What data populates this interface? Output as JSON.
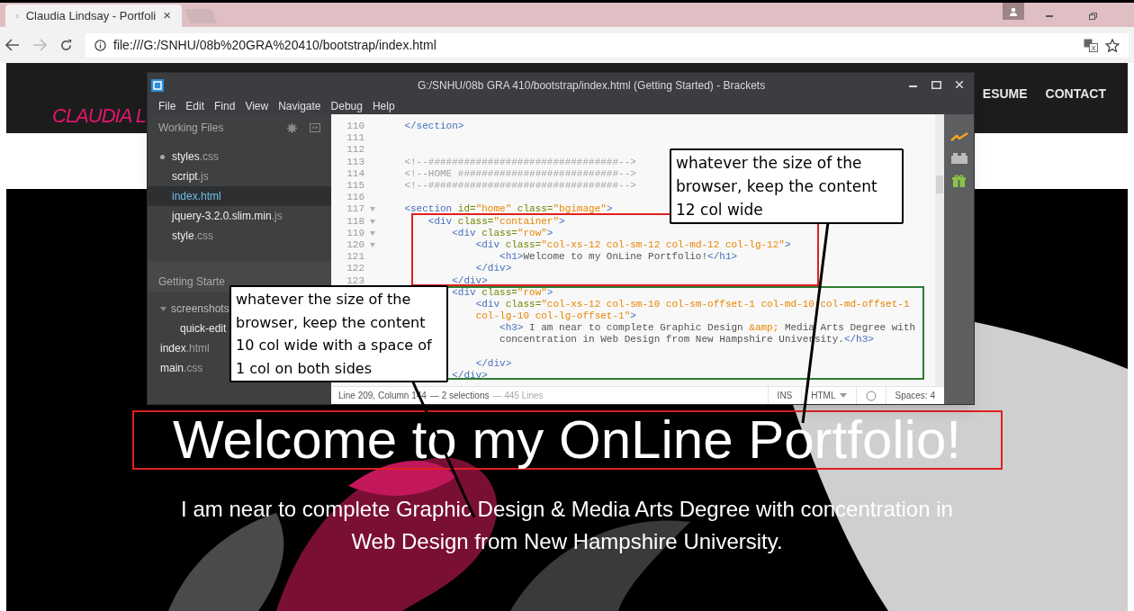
{
  "browser": {
    "tab": {
      "title": "Claudia Lindsay - Portfoli",
      "close": "×"
    },
    "url": "file:///G:/SNHU/08b%20GRA%20410/bootstrap/index.html"
  },
  "page": {
    "logo": "CLAUDIA L",
    "nav": [
      "ESUME",
      "CONTACT"
    ],
    "hero": {
      "heading": "Welcome to my OnLine Portfolio!",
      "subheading": "I am near to complete Graphic Design & Media Arts Degree with concentration in Web Design from New Hampshire University."
    }
  },
  "editor": {
    "title": "G:/SNHU/08b GRA 410/bootstrap/index.html (Getting Started) - Brackets",
    "menu": [
      "File",
      "Edit",
      "Find",
      "View",
      "Navigate",
      "Debug",
      "Help"
    ],
    "sidebar": {
      "working_files_title": "Working Files",
      "working_files": [
        {
          "name": "styles",
          "ext": ".css",
          "modified": true,
          "selected": false
        },
        {
          "name": "script",
          "ext": ".js",
          "modified": false,
          "selected": false
        },
        {
          "name": "index",
          "ext": ".html",
          "modified": false,
          "selected": true
        },
        {
          "name": "jquery-3.2.0.slim.min",
          "ext": ".js",
          "modified": false,
          "selected": false
        },
        {
          "name": "style",
          "ext": ".css",
          "modified": false,
          "selected": false
        }
      ],
      "project_title": "Getting Starte",
      "project_tree": [
        {
          "name": "screenshots",
          "expanded": true,
          "children": [
            {
              "name": "quick-edit"
            }
          ]
        },
        {
          "name": "index",
          "ext": ".html"
        },
        {
          "name": "main",
          "ext": ".css"
        }
      ]
    },
    "code": [
      {
        "number": "110",
        "fold": false,
        "tokens": [
          {
            "kind": "tag",
            "text": "    </section>"
          }
        ]
      },
      {
        "number": "111",
        "fold": false
      },
      {
        "number": "112",
        "fold": false
      },
      {
        "number": "113",
        "fold": false,
        "tokens": [
          {
            "kind": "comment",
            "text": "    <!--################################-->"
          }
        ]
      },
      {
        "number": "114",
        "fold": false,
        "tokens": [
          {
            "kind": "comment",
            "text": "    <!--HOME ###########################-->"
          }
        ]
      },
      {
        "number": "115",
        "fold": false,
        "tokens": [
          {
            "kind": "comment",
            "text": "    <!--################################-->"
          }
        ]
      },
      {
        "number": "116",
        "fold": false
      },
      {
        "number": "117",
        "fold": true,
        "tokens": [
          {
            "kind": "tag",
            "text": "    <section"
          },
          {
            "kind": "attr",
            "text": " id="
          },
          {
            "kind": "string",
            "text": "\"home\""
          },
          {
            "kind": "attr",
            "text": " class="
          },
          {
            "kind": "string",
            "text": "\"bgimage\""
          },
          {
            "kind": "tag",
            "text": ">"
          }
        ]
      },
      {
        "number": "118",
        "fold": true,
        "tokens": [
          {
            "kind": "tag",
            "text": "        <div"
          },
          {
            "kind": "attr",
            "text": " class="
          },
          {
            "kind": "string",
            "text": "\"container\""
          },
          {
            "kind": "tag",
            "text": ">"
          }
        ]
      },
      {
        "number": "119",
        "fold": true,
        "tokens": [
          {
            "kind": "tag",
            "text": "            <div"
          },
          {
            "kind": "attr",
            "text": " class="
          },
          {
            "kind": "string",
            "text": "\"row\""
          },
          {
            "kind": "tag",
            "text": ">"
          }
        ]
      },
      {
        "number": "120",
        "fold": true,
        "tokens": [
          {
            "kind": "tag",
            "text": "                <div"
          },
          {
            "kind": "attr",
            "text": " class="
          },
          {
            "kind": "string",
            "text": "\"col-xs-12 col-sm-12 col-md-12 col-lg-12\""
          },
          {
            "kind": "tag",
            "text": ">"
          }
        ]
      },
      {
        "number": "121",
        "fold": false,
        "tokens": [
          {
            "kind": "tag",
            "text": "                    <h1>"
          },
          {
            "kind": "text",
            "text": "Welcome to my OnLine Portfolio!"
          },
          {
            "kind": "tag",
            "text": "</h1>"
          }
        ]
      },
      {
        "number": "122",
        "fold": false,
        "tokens": [
          {
            "kind": "tag",
            "text": "                </div>"
          }
        ]
      },
      {
        "number": "123",
        "fold": false,
        "tokens": [
          {
            "kind": "tag",
            "text": "            </div>"
          }
        ]
      },
      {
        "tokens": [
          {
            "kind": "tag",
            "text": "            <div"
          },
          {
            "kind": "attr",
            "text": " class="
          },
          {
            "kind": "string",
            "text": "\"row\""
          },
          {
            "kind": "tag",
            "text": ">"
          }
        ]
      },
      {
        "tokens": [
          {
            "kind": "tag",
            "text": "                <div"
          },
          {
            "kind": "attr",
            "text": " class="
          },
          {
            "kind": "string",
            "text": "\"col-xs-12 col-sm-10 col-sm-offset-1 col-md-10 col-md-offset-1"
          }
        ]
      },
      {
        "tokens": [
          {
            "kind": "string",
            "text": "                col-lg-10 col-lg-offset-1\""
          },
          {
            "kind": "tag",
            "text": ">"
          }
        ]
      },
      {
        "tokens": [
          {
            "kind": "tag",
            "text": "                    <h3>"
          },
          {
            "kind": "text",
            "text": " I am near to complete Graphic Design "
          },
          {
            "kind": "string",
            "text": "&amp;"
          },
          {
            "kind": "text",
            "text": " Media Arts Degree with"
          }
        ]
      },
      {
        "tokens": [
          {
            "kind": "text",
            "text": "                    concentration in Web Design from New Hampshire University."
          },
          {
            "kind": "tag",
            "text": "</h3>"
          }
        ]
      },
      {
        "gap_before": true,
        "tokens": [
          {
            "kind": "tag",
            "text": "                </div>"
          }
        ]
      },
      {
        "tokens": [
          {
            "kind": "tag",
            "text": "            </div>"
          }
        ]
      }
    ],
    "status": {
      "position": "Line 209, Column 144",
      "selections": "— 2 selections",
      "lines": "— 445 Lines",
      "mode": "INS",
      "language": "HTML",
      "indent": "Spaces: 4"
    }
  },
  "annotations": [
    {
      "text": "whatever the size of the browser, keep the content 12 col wide"
    },
    {
      "text": "whatever the size of the browser, keep the content 10 col wide with a space of 1 col on both sides"
    }
  ]
}
